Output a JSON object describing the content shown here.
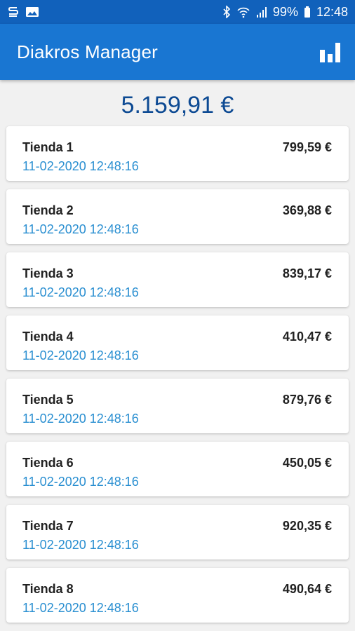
{
  "status_bar": {
    "left_icons": [
      "s-notification-icon",
      "image-notification-icon"
    ],
    "battery": "99%",
    "time": "12:48"
  },
  "app_bar": {
    "title": "Diakros Manager",
    "action_icon": "bar-chart-icon"
  },
  "summary": {
    "total": "5.159,91 €"
  },
  "stores": [
    {
      "name": "Tienda 1",
      "date": "11-02-2020 12:48:16",
      "amount": "799,59 €"
    },
    {
      "name": "Tienda 2",
      "date": "11-02-2020 12:48:16",
      "amount": "369,88 €"
    },
    {
      "name": "Tienda 3",
      "date": "11-02-2020 12:48:16",
      "amount": "839,17 €"
    },
    {
      "name": "Tienda 4",
      "date": "11-02-2020 12:48:16",
      "amount": "410,47 €"
    },
    {
      "name": "Tienda 5",
      "date": "11-02-2020 12:48:16",
      "amount": "879,76 €"
    },
    {
      "name": "Tienda 6",
      "date": "11-02-2020 12:48:16",
      "amount": "450,05 €"
    },
    {
      "name": "Tienda 7",
      "date": "11-02-2020 12:48:16",
      "amount": "920,35 €"
    },
    {
      "name": "Tienda 8",
      "date": "11-02-2020 12:48:16",
      "amount": "490,64 €"
    }
  ],
  "colors": {
    "status_bar": "#1161bb",
    "app_bar": "#1976d2",
    "total_text": "#0d4a93",
    "date_text": "#2a8fd1",
    "background": "#f1f1f1"
  }
}
